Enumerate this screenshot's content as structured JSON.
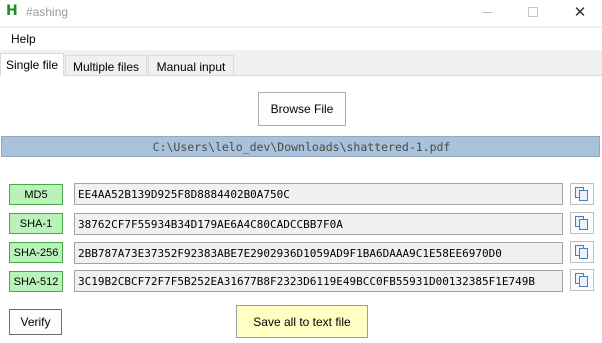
{
  "window": {
    "icon_letter": "H",
    "title": "#ashing",
    "minimize_icon": "minimize-icon",
    "maximize_icon": "maximize-icon",
    "close_icon": "close-icon",
    "close_glyph": "✕"
  },
  "menu": {
    "help_label": "Help"
  },
  "tabs": [
    {
      "label": "Single file",
      "active": true
    },
    {
      "label": "Multiple files",
      "active": false
    },
    {
      "label": "Manual input",
      "active": false
    }
  ],
  "single_file": {
    "browse_label": "Browse File",
    "file_path": "C:\\Users\\lelo_dev\\Downloads\\shattered-1.pdf",
    "hashes": [
      {
        "algorithm": "MD5",
        "value": "EE4AA52B139D925F8D8884402B0A750C"
      },
      {
        "algorithm": "SHA-1",
        "value": "38762CF7F55934B34D179AE6A4C80CADCCBB7F0A"
      },
      {
        "algorithm": "SHA-256",
        "value": "2BB787A73E37352F92383ABE7E2902936D1059AD9F1BA6DAAA9C1E58EE6970D0"
      },
      {
        "algorithm": "SHA-512",
        "value": "3C19B2CBCF72F7F5B252EA31677B8F2323D6119E49BCC0FB55931D00132385F1E749B"
      }
    ],
    "copy_icon": "copy-icon",
    "verify_label": "Verify",
    "save_label": "Save all to text file"
  },
  "colors": {
    "hash_label_bg": "#b9f3b9",
    "path_bar_bg": "#a8c2da",
    "save_button_bg": "#ffffc3",
    "app_icon": "#1e8c1e"
  }
}
